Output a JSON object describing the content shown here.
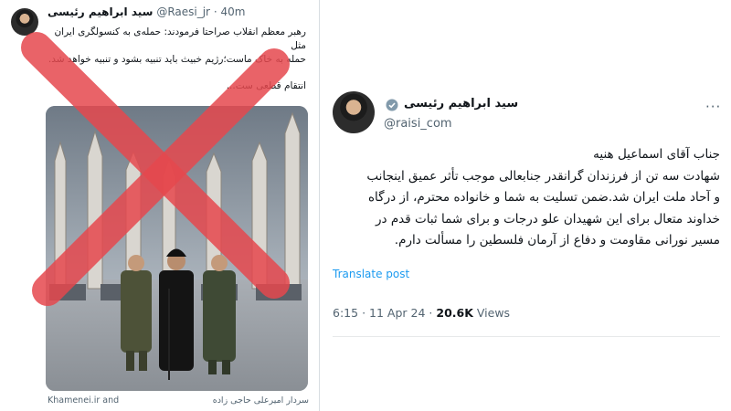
{
  "left_tweet": {
    "author_name": "سید ابراهیم رئیسی",
    "handle": "@Raesi_jr",
    "separator": "·",
    "time": "40m",
    "lines": [
      "رهبر معظم انقلاب صراحتا فرمودند: حمله‌ی به کنسولگری ایران مثل",
      "حمله به خاک ماست؛رژیم خبیث باید تنبیه بشود و تنبیه خواهد شد."
    ],
    "closing": "انتقام قطعی ست...",
    "image_source": "Khamenei.ir and",
    "image_caption": "سردار امیرعلی حاجی زاده"
  },
  "right_tweet": {
    "author_name": "سید ابراهیم رئیسی",
    "handle": "@raisi_com",
    "more_icon": "···",
    "lines": [
      "جناب آقای اسماعیل هنیه",
      "شهادت سه تن از فرزندان گرانقدر جنابعالی موجب تأثر عمیق اینجانب",
      "و آحاد ملت ایران شد.ضمن تسلیت به شما و خانواده محترم، از درگاه",
      "خداوند متعال برای این شهیدان علو درجات و برای شما ثبات قدم در",
      "مسیر نورانی مقاومت و دفاع از آرمان فلسطین را مسألت دارم."
    ],
    "translate_label": "Translate post",
    "time": "6:15",
    "date": "11 Apr 24",
    "dot": "·",
    "views_count": "20.6K",
    "views_label": "Views"
  },
  "colors": {
    "accent": "#1d9bf0",
    "verified": "#829aab",
    "cross": "#e5484d",
    "text": "#0f1419",
    "muted": "#536471"
  }
}
